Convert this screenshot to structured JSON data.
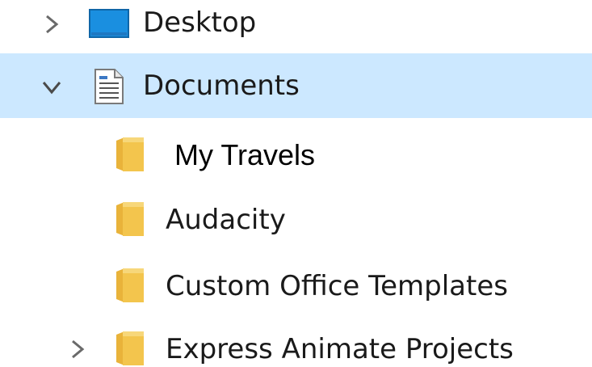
{
  "tree": {
    "items": [
      {
        "label": "Desktop",
        "icon": "desktop-icon",
        "expander": "chevron-right-icon"
      },
      {
        "label": "Documents",
        "icon": "document-icon",
        "expander": "chevron-down-icon",
        "selected": true
      },
      {
        "label": "My Travels",
        "icon": "folder-icon"
      },
      {
        "label": "Audacity",
        "icon": "folder-icon"
      },
      {
        "label": "Custom Office Templates",
        "icon": "folder-icon"
      },
      {
        "label": "Express Animate Projects",
        "icon": "folder-icon",
        "expander": "chevron-right-icon"
      }
    ]
  },
  "colors": {
    "selection": "#cce8ff",
    "folder": "#f3c54d",
    "desktop_icon": "#1a8fe0",
    "chevron": "#6a6a6a"
  }
}
